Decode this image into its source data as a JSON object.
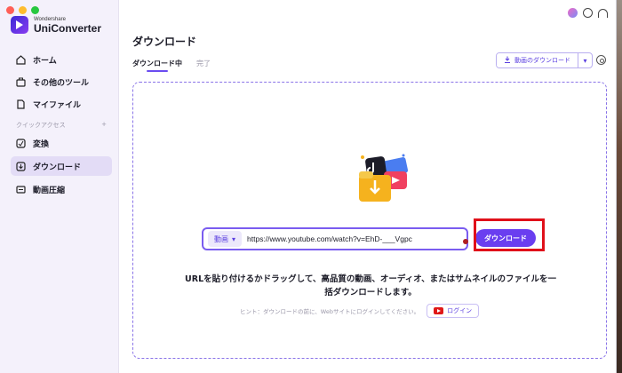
{
  "app": {
    "brand_small": "Wondershare",
    "brand_name": "UniConverter"
  },
  "sidebar": {
    "items": [
      {
        "label": "ホーム",
        "icon": "home-icon"
      },
      {
        "label": "その他のツール",
        "icon": "toolbox-icon"
      },
      {
        "label": "マイファイル",
        "icon": "file-icon"
      }
    ],
    "section_label": "クイックアクセス",
    "section_add": "+",
    "quick_items": [
      {
        "label": "変換",
        "icon": "convert-icon"
      },
      {
        "label": "ダウンロード",
        "icon": "download-icon",
        "active": true
      },
      {
        "label": "動画圧縮",
        "icon": "compress-icon"
      }
    ]
  },
  "main": {
    "title": "ダウンロード",
    "tabs": [
      {
        "label": "ダウンロード中",
        "active": true
      },
      {
        "label": "完了",
        "active": false
      }
    ],
    "download_video_button": "動画のダウンロード",
    "dropdown_arrow": "▾"
  },
  "url_bar": {
    "type_label": "動画",
    "type_arrow": "▾",
    "url_value": "https://www.youtube.com/watch?v=EhD-___Vgpc",
    "download_button": "ダウンロード"
  },
  "instructions": {
    "headline_line1": "URLを貼り付けるかドラッグして、高品質の動画、オーディオ、またはサムネイルのファイルを一",
    "headline_line2": "括ダウンロードします。",
    "hint": "ヒント：ダウンロードの前に、Webサイトにログインしてください。",
    "login_button": "ログイン"
  },
  "colors": {
    "accent": "#6a3ef0",
    "highlight": "#e0101a",
    "sidebar_bg": "#f4f1fb"
  }
}
